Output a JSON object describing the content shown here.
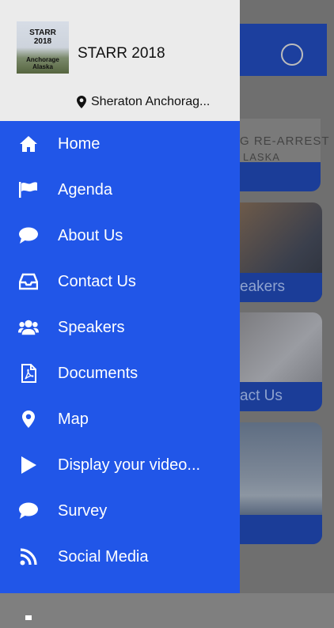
{
  "background": {
    "banner_line1": "G RE-ARREST",
    "banner_line2": "LASKA",
    "tiles": [
      "eakers",
      "act Us",
      ""
    ]
  },
  "drawer": {
    "logo_line1": "STARR 2018",
    "logo_line2": "Anchorage Alaska",
    "app_title": "STARR 2018",
    "location": "Sheraton Anchorag..."
  },
  "menu": [
    {
      "label": "Home",
      "icon": "home-icon"
    },
    {
      "label": "Agenda",
      "icon": "flag-icon"
    },
    {
      "label": "About Us",
      "icon": "chat-bubble-icon"
    },
    {
      "label": "Contact Us",
      "icon": "inbox-icon"
    },
    {
      "label": "Speakers",
      "icon": "users-icon"
    },
    {
      "label": "Documents",
      "icon": "pdf-icon"
    },
    {
      "label": "Map",
      "icon": "map-pin-icon"
    },
    {
      "label": "Display your video...",
      "icon": "play-icon"
    },
    {
      "label": "Survey",
      "icon": "chat-bubble-icon"
    },
    {
      "label": "Social Media",
      "icon": "rss-icon"
    }
  ],
  "colors": {
    "drawer": "#2156e8",
    "header": "#ebebeb"
  }
}
